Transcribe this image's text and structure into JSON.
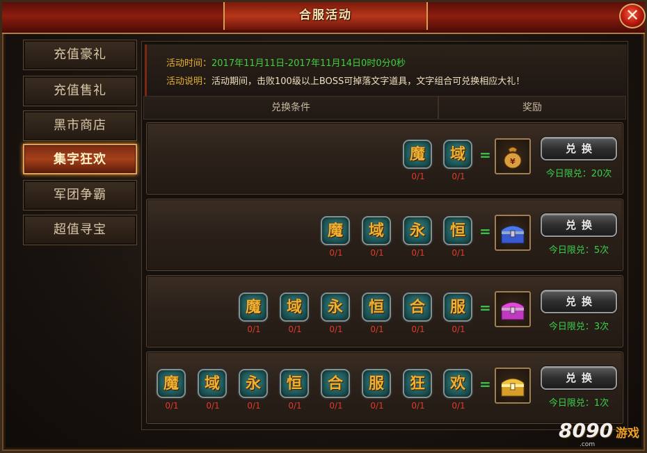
{
  "window": {
    "title": "合服活动",
    "close_label": "✕"
  },
  "sidebar": {
    "items": [
      {
        "label": "充值豪礼",
        "active": false
      },
      {
        "label": "充值售礼",
        "active": false
      },
      {
        "label": "黑市商店",
        "active": false
      },
      {
        "label": "集字狂欢",
        "active": true
      },
      {
        "label": "军团争霸",
        "active": false
      },
      {
        "label": "超值寻宝",
        "active": false
      }
    ]
  },
  "info": {
    "time_label": "活动时间：",
    "time_value": "2017年11月11日-2017年11月14日0时0分0秒",
    "desc_label": "活动说明：",
    "desc_value": "活动期间，击败100级以上BOSS可掉落文字道具，文字组合可兑换相应大礼！"
  },
  "columns": {
    "condition": "兑换条件",
    "reward": "奖励"
  },
  "rows": [
    {
      "chars": [
        {
          "char": "魔",
          "count": "0/1"
        },
        {
          "char": "域",
          "count": "0/1"
        }
      ],
      "equals": "=",
      "reward_icon": "money-bag-icon",
      "button": "兑换",
      "limit": "今日限兑：20次"
    },
    {
      "chars": [
        {
          "char": "魔",
          "count": "0/1"
        },
        {
          "char": "域",
          "count": "0/1"
        },
        {
          "char": "永",
          "count": "0/1"
        },
        {
          "char": "恒",
          "count": "0/1"
        }
      ],
      "equals": "=",
      "reward_icon": "blue-chest-icon",
      "button": "兑换",
      "limit": "今日限兑：5次"
    },
    {
      "chars": [
        {
          "char": "魔",
          "count": "0/1"
        },
        {
          "char": "域",
          "count": "0/1"
        },
        {
          "char": "永",
          "count": "0/1"
        },
        {
          "char": "恒",
          "count": "0/1"
        },
        {
          "char": "合",
          "count": "0/1"
        },
        {
          "char": "服",
          "count": "0/1"
        }
      ],
      "equals": "=",
      "reward_icon": "purple-chest-icon",
      "button": "兑换",
      "limit": "今日限兑：3次"
    },
    {
      "chars": [
        {
          "char": "魔",
          "count": "0/1"
        },
        {
          "char": "域",
          "count": "0/1"
        },
        {
          "char": "永",
          "count": "0/1"
        },
        {
          "char": "恒",
          "count": "0/1"
        },
        {
          "char": "合",
          "count": "0/1"
        },
        {
          "char": "服",
          "count": "0/1"
        },
        {
          "char": "狂",
          "count": "0/1"
        },
        {
          "char": "欢",
          "count": "0/1"
        }
      ],
      "equals": "=",
      "reward_icon": "gold-chest-icon",
      "button": "兑换",
      "limit": "今日限兑：1次"
    }
  ],
  "watermark": {
    "logo": "8090",
    "game": "游戏",
    "domain": ".com"
  },
  "colors": {
    "accent_gold": "#e8b030",
    "success_green": "#39d04a",
    "count_red": "#e23a2a",
    "time_green": "#3fd03f",
    "tile_teal": "#1f5a5c",
    "chest_blue": "#3a6ad8",
    "chest_purple": "#c83ac8",
    "chest_gold": "#e0b030"
  }
}
